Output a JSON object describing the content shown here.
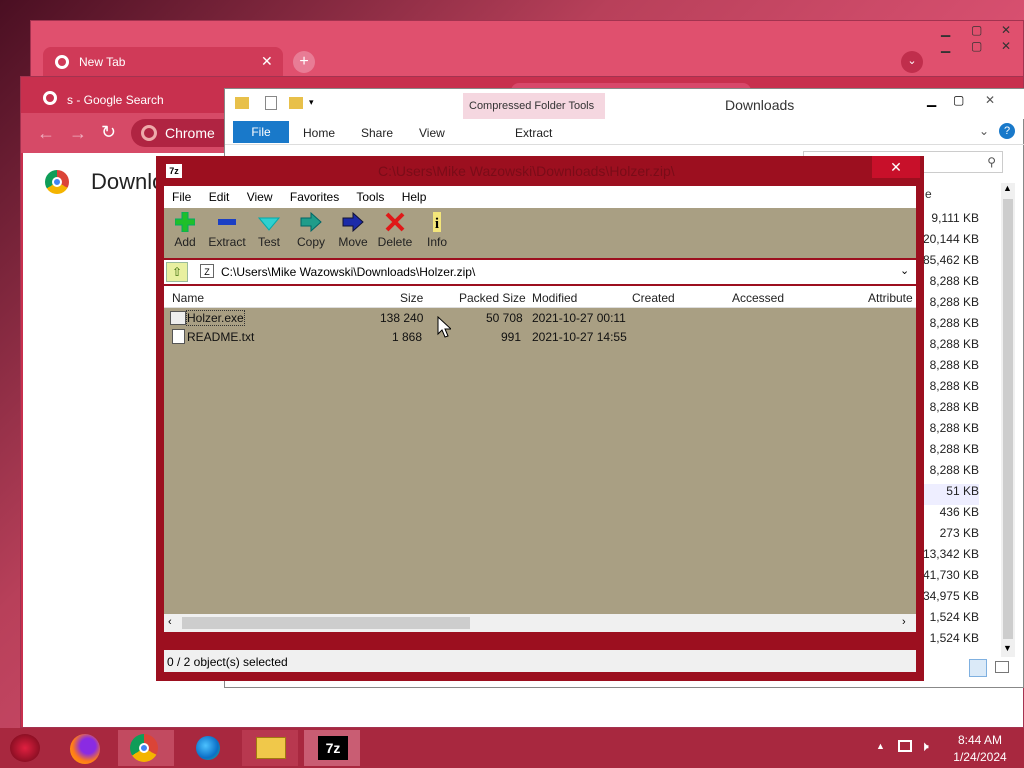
{
  "chrome_back": {
    "tab_title": "New Tab"
  },
  "chrome_mid": {
    "tab_title": "s - Google Search",
    "omnibox_label": "Chrome",
    "page_heading": "Downlo"
  },
  "explorer": {
    "context_tab": "Compressed Folder Tools",
    "title": "Downloads",
    "ribbon_tabs": [
      "File",
      "Home",
      "Share",
      "View"
    ],
    "context_action": "Extract",
    "size_column_header": "e",
    "sizes": [
      "9,111 KB",
      "20,144 KB",
      "85,462 KB",
      "8,288 KB",
      "8,288 KB",
      "8,288 KB",
      "8,288 KB",
      "8,288 KB",
      "8,288 KB",
      "8,288 KB",
      "8,288 KB",
      "8,288 KB",
      "8,288 KB",
      "51 KB",
      "436 KB",
      "273 KB",
      "13,342 KB",
      "41,730 KB",
      "34,975 KB",
      "1,524 KB",
      "1,524 KB"
    ]
  },
  "sevenzip": {
    "title": "C:\\Users\\Mike Wazowski\\Downloads\\Holzer.zip\\",
    "menu": [
      "File",
      "Edit",
      "View",
      "Favorites",
      "Tools",
      "Help"
    ],
    "toolbar": [
      {
        "label": "Add",
        "icon": "plus-icon"
      },
      {
        "label": "Extract",
        "icon": "minus-icon"
      },
      {
        "label": "Test",
        "icon": "check-icon"
      },
      {
        "label": "Copy",
        "icon": "copy-arrow-icon"
      },
      {
        "label": "Move",
        "icon": "move-arrow-icon"
      },
      {
        "label": "Delete",
        "icon": "delete-x-icon"
      },
      {
        "label": "Info",
        "icon": "info-icon"
      }
    ],
    "path": "C:\\Users\\Mike Wazowski\\Downloads\\Holzer.zip\\",
    "columns": [
      "Name",
      "Size",
      "Packed Size",
      "Modified",
      "Created",
      "Accessed",
      "Attribute"
    ],
    "files": [
      {
        "name": "Holzer.exe",
        "size": "138 240",
        "packed": "50 708",
        "modified": "2021-10-27 00:11"
      },
      {
        "name": "README.txt",
        "size": "1 868",
        "packed": "991",
        "modified": "2021-10-27 14:55"
      }
    ],
    "status": "0 / 2 object(s) selected"
  },
  "taskbar": {
    "time": "8:44 AM",
    "date": "1/24/2024"
  },
  "colors": {
    "sevenzip_frame": "#9c0f1f",
    "list_bg": "#a99f83",
    "taskbar": "#a8283f",
    "explorer_accent": "#1979ca"
  }
}
